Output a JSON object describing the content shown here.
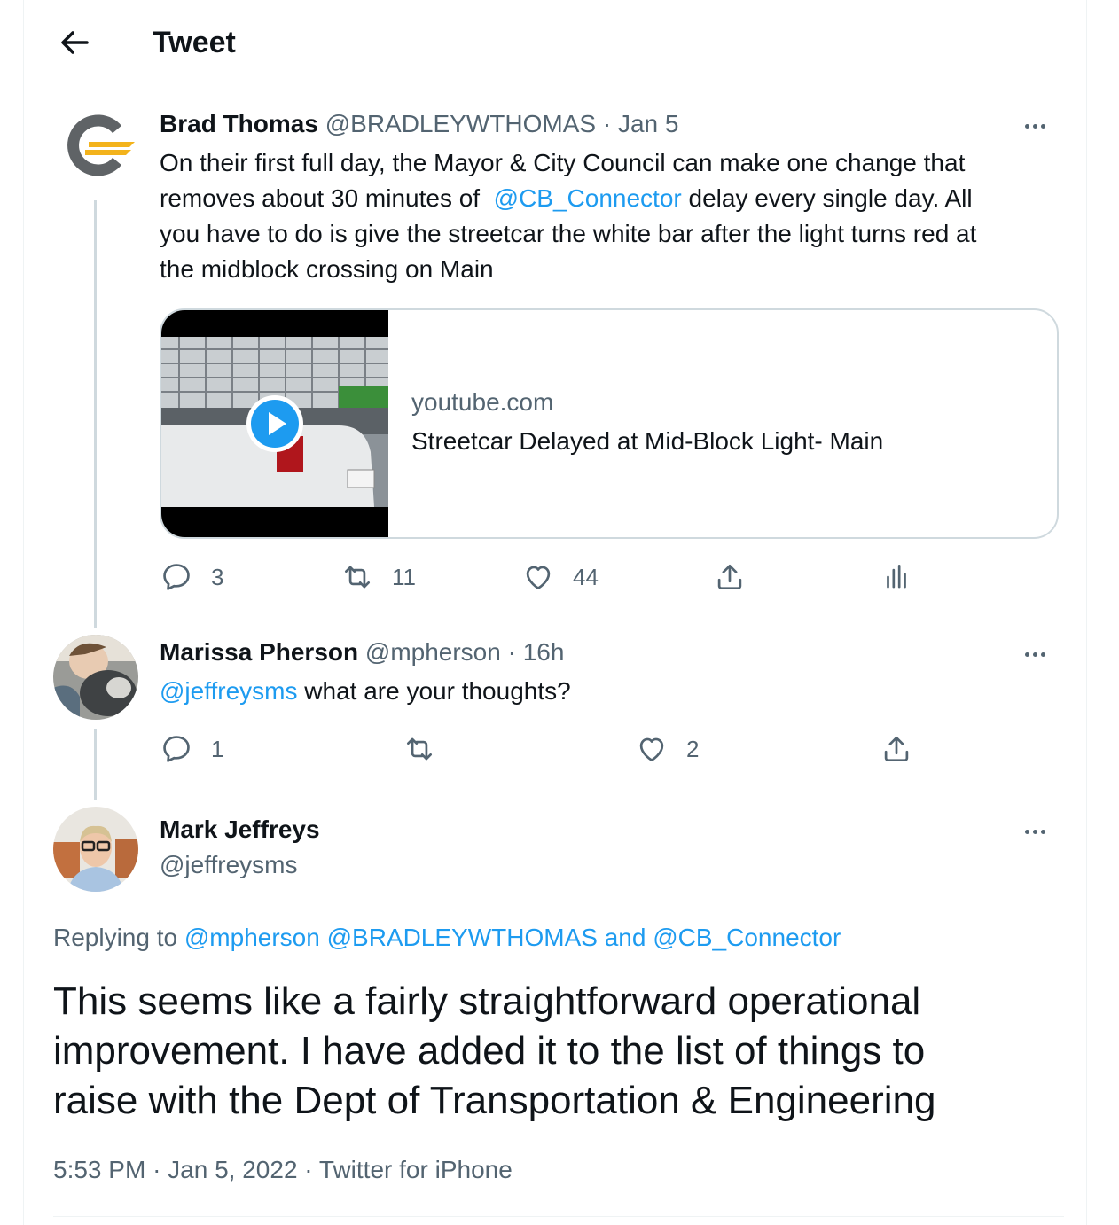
{
  "header": {
    "title": "Tweet"
  },
  "tweets": [
    {
      "name": "Brad Thomas",
      "handle": "@BRADLEYWTHOMAS",
      "sep": "·",
      "time": "Jan 5",
      "text_1": "On their first full day, the Mayor & City Council can make one change that",
      "text_2a": "removes about 30 minutes of",
      "mention": "@CB_Connector",
      "text_2b": "delay every single day. All",
      "text_3": "you have to do is give the streetcar the white bar after the light turns red at",
      "text_4": "the midblock crossing on Main",
      "card": {
        "domain": "youtube.com",
        "title": "Streetcar Delayed at Mid-Block Light- Main"
      },
      "stats": {
        "replies": "3",
        "retweets": "11",
        "likes": "44"
      }
    },
    {
      "name": "Marissa Pherson",
      "handle": "@mpherson",
      "sep": "·",
      "time": "16h",
      "mention": "@jeffreysms",
      "text": "what are your thoughts?",
      "stats": {
        "replies": "1",
        "retweets": "",
        "likes": "2"
      }
    }
  ],
  "focus": {
    "name": "Mark Jeffreys",
    "handle": "@jeffreysms",
    "replying_prefix": "Replying to",
    "replying_1": "@mpherson",
    "replying_2": "@BRADLEYWTHOMAS",
    "replying_and": "and",
    "replying_3": "@CB_Connector",
    "text_1": "This seems like a fairly straightforward operational",
    "text_2": "improvement. I have added it to the list of things to",
    "text_3": "raise with the Dept of Transportation & Engineering",
    "time": "5:53 PM",
    "sep": "·",
    "date": "Jan 5, 2022",
    "source": "Twitter for iPhone"
  },
  "colors": {
    "link": "#1d9bf0",
    "secondary": "#536471",
    "border": "#cfd9de"
  }
}
